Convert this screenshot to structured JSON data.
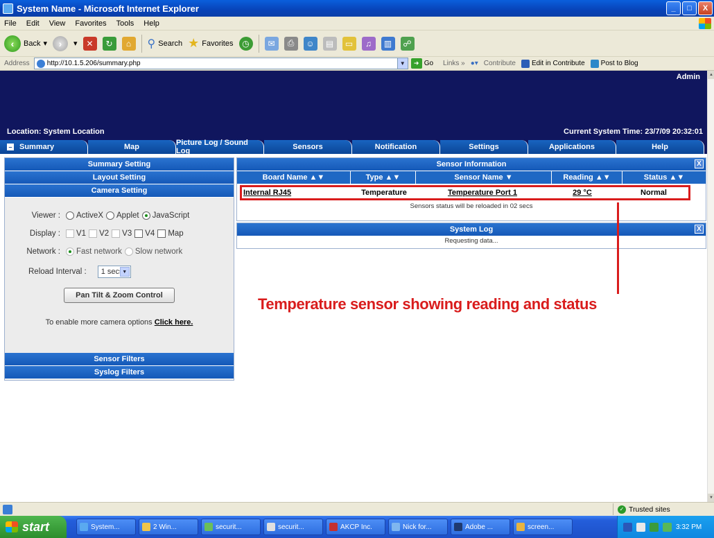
{
  "window": {
    "title": "System Name - Microsoft Internet Explorer",
    "buttons": {
      "minimize": "_",
      "maximize": "□",
      "close": "X"
    }
  },
  "menubar": [
    "File",
    "Edit",
    "View",
    "Favorites",
    "Tools",
    "Help"
  ],
  "toolbar": {
    "back_label": "Back",
    "search_label": "Search",
    "favorites_label": "Favorites"
  },
  "addressbar": {
    "label": "Address",
    "url": "http://10.1.5.206/summary.php",
    "go_label": "Go",
    "links_label": "Links",
    "contribute_label": "Contribute",
    "edit_in_contribute": "Edit in Contribute",
    "post_to_blog": "Post to Blog"
  },
  "header": {
    "user": "Admin",
    "location": "Location: System Location",
    "system_time": "Current System Time: 23/7/09 20:32:01"
  },
  "tabs": [
    {
      "label": "Summary",
      "active": true
    },
    {
      "label": "Map"
    },
    {
      "label": "Picture Log / Sound Log"
    },
    {
      "label": "Sensors"
    },
    {
      "label": "Notification"
    },
    {
      "label": "Settings"
    },
    {
      "label": "Applications"
    },
    {
      "label": "Help"
    }
  ],
  "left_panel": {
    "summary_setting": "Summary Setting",
    "layout_setting": "Layout Setting",
    "camera_setting": "Camera Setting",
    "viewer": {
      "label": "Viewer :",
      "options": [
        "ActiveX",
        "Applet",
        "JavaScript"
      ],
      "selected": "JavaScript"
    },
    "display": {
      "label": "Display :",
      "options": [
        "V1",
        "V2",
        "V3",
        "V4",
        "Map"
      ]
    },
    "network": {
      "label": "Network :",
      "options": [
        "Fast network",
        "Slow network"
      ],
      "selected": "Fast network"
    },
    "reload_interval": {
      "label": "Reload Interval :",
      "value": "1 secs"
    },
    "ptz_button": "Pan Tilt & Zoom Control",
    "enable_text": "To enable more camera options",
    "enable_link": "Click here.",
    "sensor_filters": "Sensor Filters",
    "syslog_filters": "Syslog Filters"
  },
  "sensor_info": {
    "title": "Sensor Information",
    "close": "X",
    "columns": [
      "Board Name ▲▼",
      "Type ▲▼",
      "Sensor Name ▼",
      "Reading ▲▼",
      "Status ▲▼"
    ],
    "row": {
      "board": "Internal RJ45",
      "type": "Temperature",
      "sensor": "Temperature Port 1",
      "reading": "29 °C",
      "status": "Normal"
    },
    "reload_note": "Sensors status will be reloaded in 02 secs"
  },
  "system_log": {
    "title": "System Log",
    "close": "X",
    "status": "Requesting data..."
  },
  "annotation": "Temperature sensor showing reading and status",
  "statusbar": {
    "zone": "Trusted sites"
  },
  "taskbar": {
    "start": "start",
    "items": [
      "System...",
      "2 Win...",
      "securit...",
      "securit...",
      "AKCP Inc.",
      "Nick for...",
      "Adobe ...",
      "screen..."
    ],
    "clock": "3:32 PM"
  },
  "colors": {
    "header_navy": "#10165e",
    "tab_blue": "#1559b8",
    "annotation_red": "#d91c1c"
  }
}
